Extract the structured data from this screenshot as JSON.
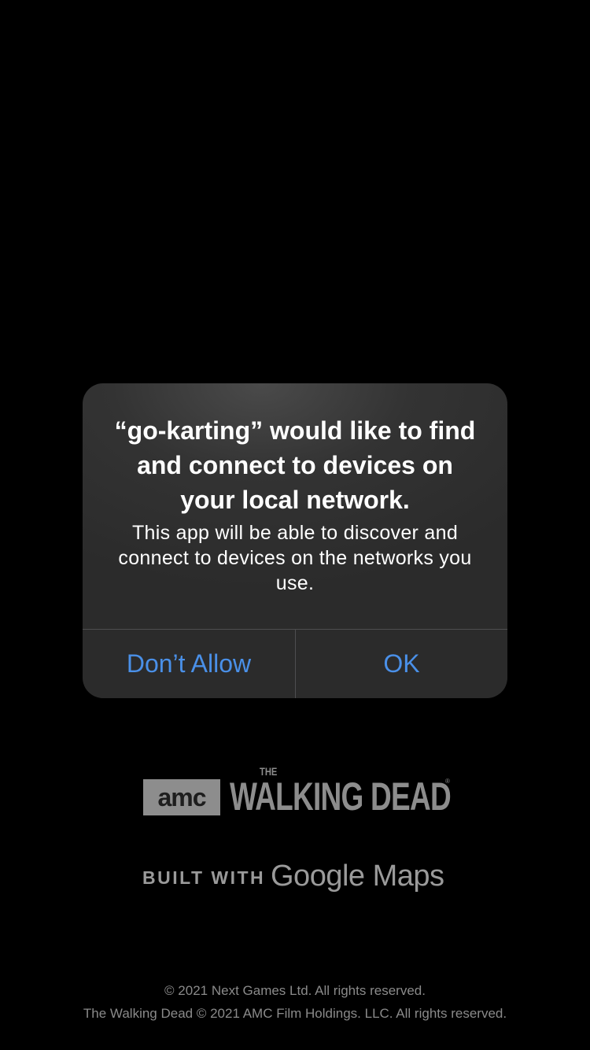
{
  "alert": {
    "title": "“go-karting” would like to find and connect to devices on your local network.",
    "message": "This app will be able to discover and connect to devices on the networks you use.",
    "deny_label": "Don’t Allow",
    "ok_label": "OK",
    "accent_color": "#4a90e8"
  },
  "splash": {
    "logo": {
      "amc": "amc",
      "the": "THE",
      "title": "WALKING DEAD",
      "tm": "®"
    },
    "built_with": "BUILT WITH",
    "google_maps": "Google Maps",
    "copyright_1": "© 2021 Next Games Ltd. All rights reserved.",
    "copyright_2": "The Walking Dead © 2021 AMC Film Holdings. LLC. All rights reserved."
  }
}
